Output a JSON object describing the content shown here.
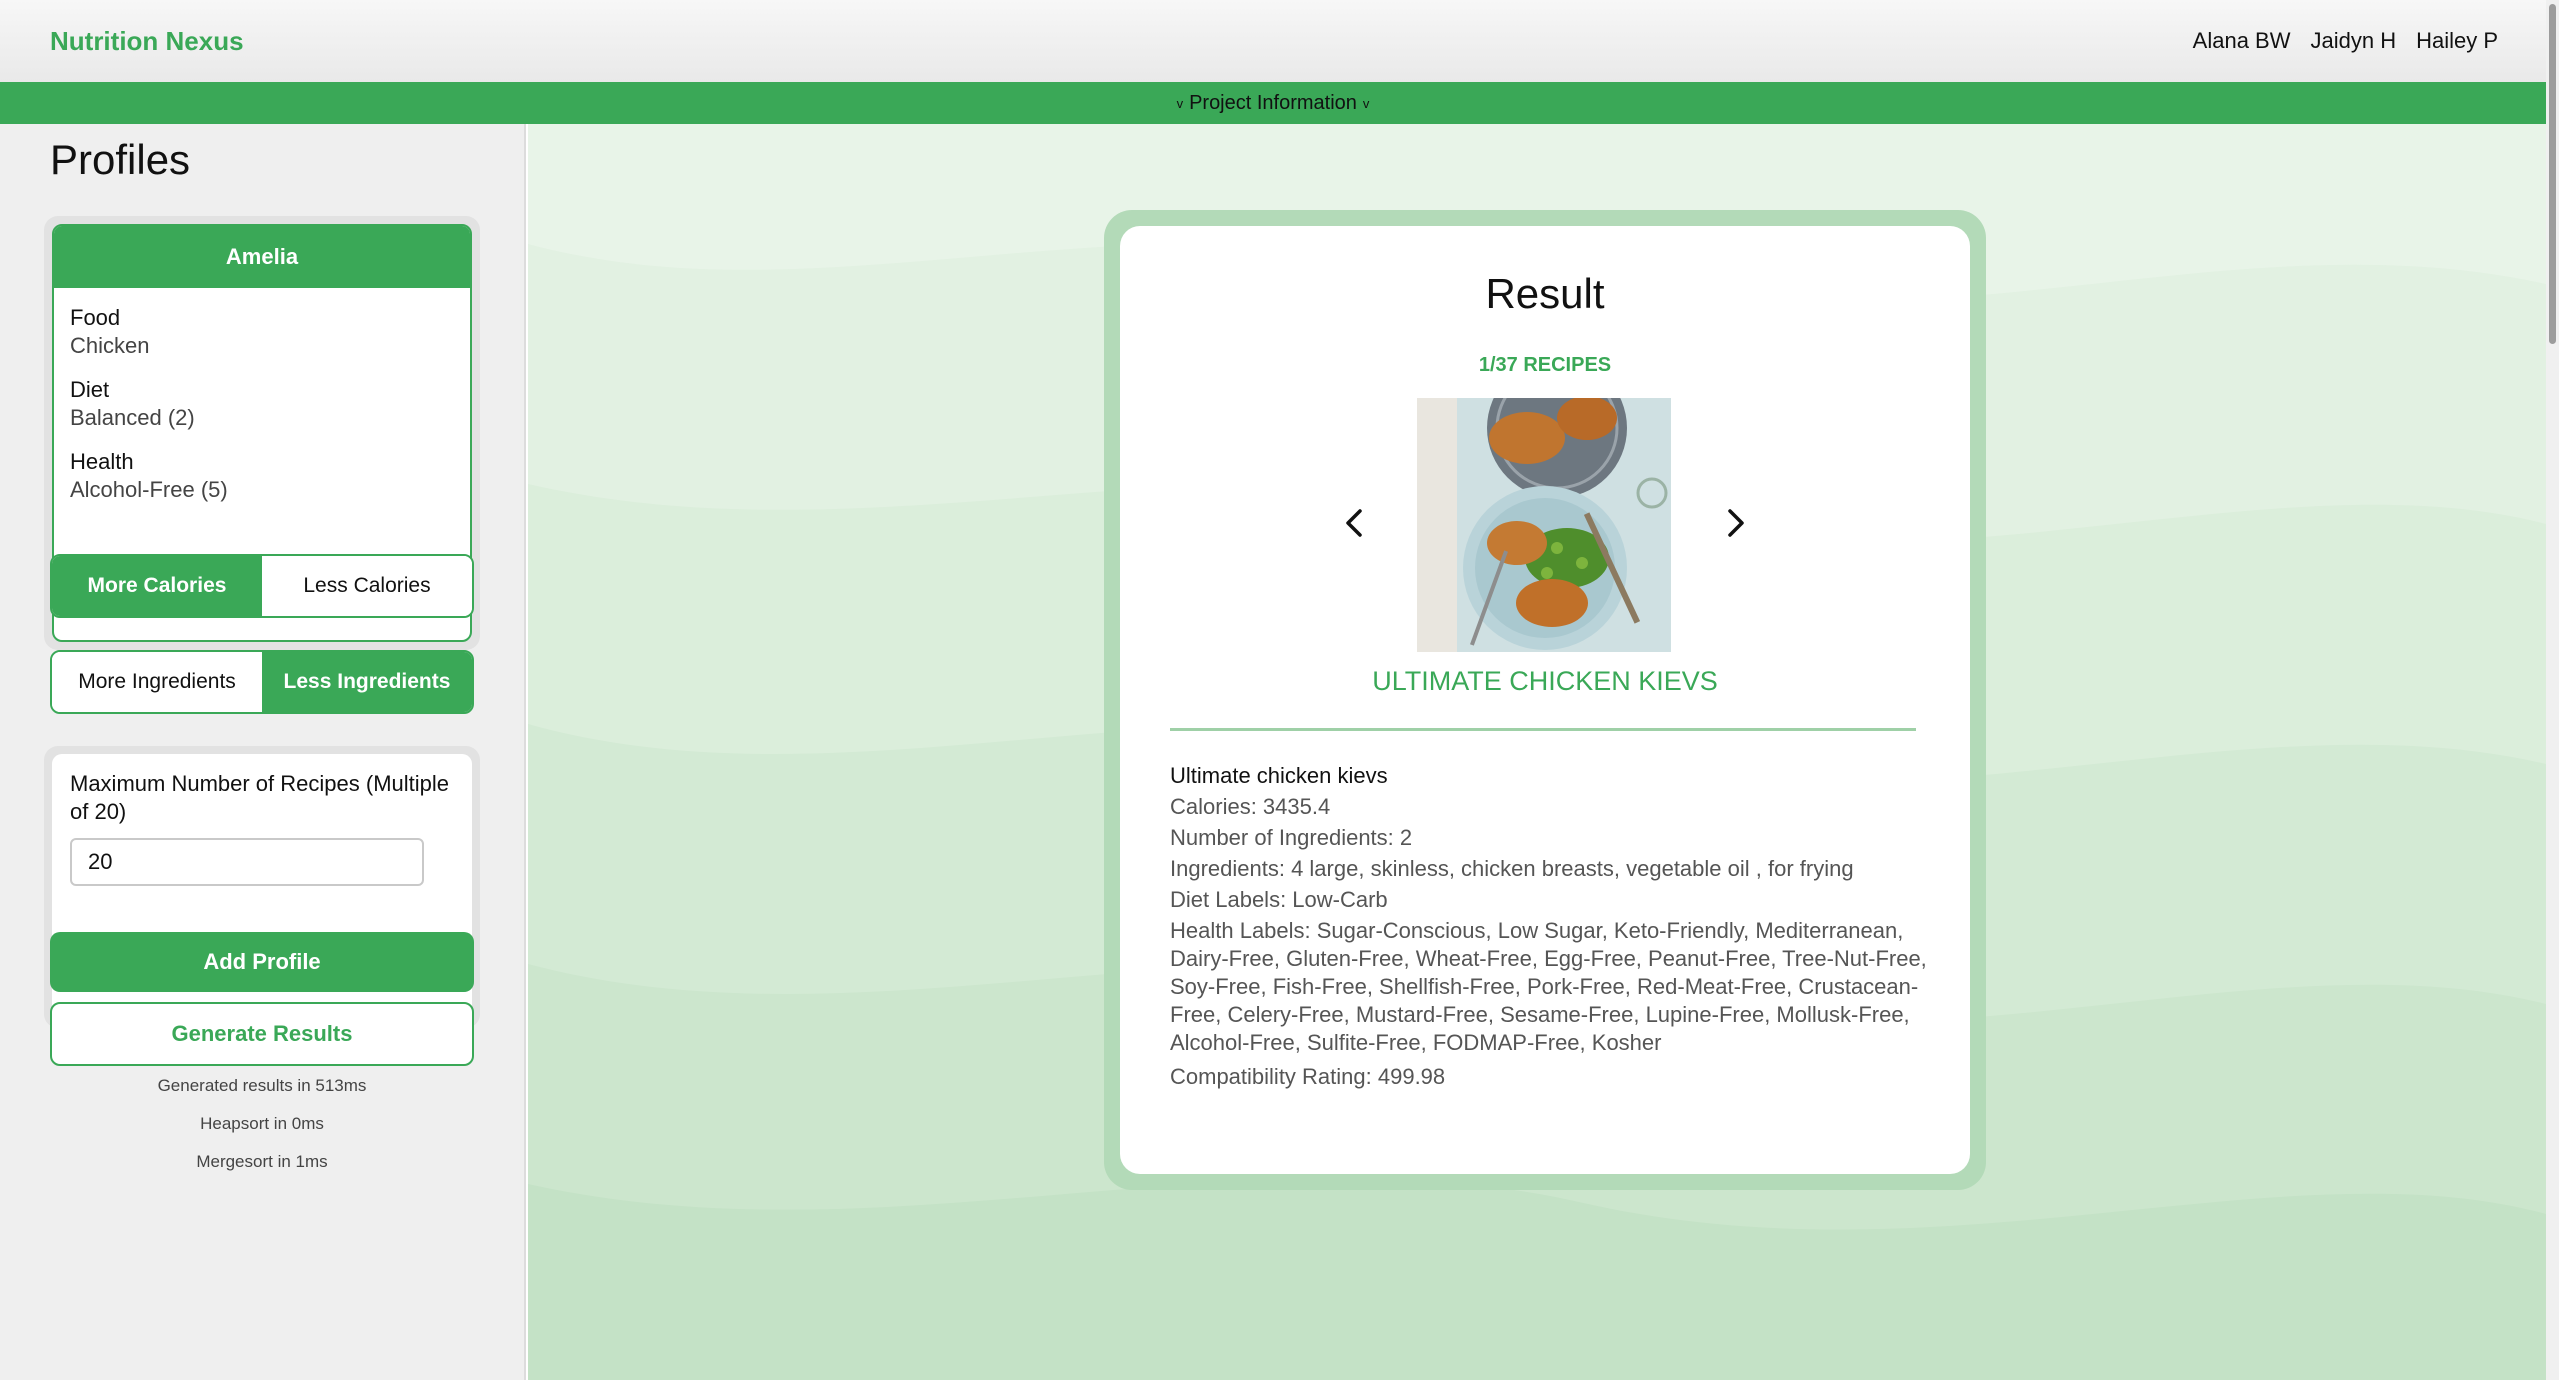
{
  "header": {
    "brand": "Nutrition Nexus",
    "team": [
      "Alana BW",
      "Jaidyn H",
      "Hailey P"
    ]
  },
  "infobar": {
    "caret_left": "v",
    "label": "Project Information",
    "caret_right": "v"
  },
  "sidebar": {
    "title": "Profiles",
    "profile": {
      "name": "Amelia",
      "fields": [
        {
          "label": "Food",
          "value": "Chicken"
        },
        {
          "label": "Diet",
          "value": "Balanced (2)"
        },
        {
          "label": "Health",
          "value": "Alcohol-Free (5)"
        }
      ]
    },
    "calories_toggle": {
      "more": "More Calories",
      "less": "Less Calories",
      "selected": "more"
    },
    "ingredients_toggle": {
      "more": "More Ingredients",
      "less": "Less Ingredients",
      "selected": "less"
    },
    "max_recipes": {
      "label": "Maximum Number of Recipes (Multiple of 20)",
      "value": "20"
    },
    "add_profile": "Add Profile",
    "generate_results": "Generate Results",
    "stats": [
      "Generated results in 513ms",
      "Heapsort in 0ms",
      "Mergesort in 1ms"
    ]
  },
  "result": {
    "title": "Result",
    "count": "1/37 RECIPES",
    "recipe_name": "ULTIMATE CHICKEN KIEVS",
    "details": {
      "title": "Ultimate chicken kievs",
      "calories": "Calories: 3435.4",
      "num_ingredients": "Number of Ingredients: 2",
      "ingredients": "Ingredients: 4 large, skinless, chicken breasts, vegetable oil , for frying",
      "diet_labels": "Diet Labels: Low-Carb",
      "health_labels": "Health Labels: Sugar-Conscious, Low Sugar, Keto-Friendly, Mediterranean, Dairy-Free, Gluten-Free, Wheat-Free, Egg-Free, Peanut-Free, Tree-Nut-Free, Soy-Free, Fish-Free, Shellfish-Free, Pork-Free, Red-Meat-Free, Crustacean-Free, Celery-Free, Mustard-Free, Sesame-Free, Lupine-Free, Mollusk-Free, Alcohol-Free, Sulfite-Free, FODMAP-Free, Kosher",
      "compatibility": "Compatibility Rating: 499.98"
    }
  },
  "colors": {
    "accent": "#3aa857",
    "card_border": "#b3dab8",
    "main_bg": "#e8f4e8"
  },
  "icons": {
    "prev": "chevron-left-icon",
    "next": "chevron-right-icon"
  }
}
